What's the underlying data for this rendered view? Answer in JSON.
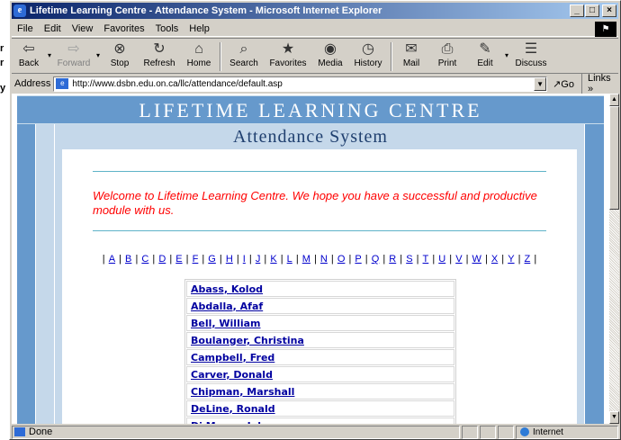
{
  "window": {
    "title": "Lifetime Learning Centre - Attendance System - Microsoft Internet Explorer",
    "buttons": {
      "minimize": "_",
      "maximize": "□",
      "close": "×"
    }
  },
  "outside_text": {
    "a": "r",
    "b": "r",
    "c": "y"
  },
  "menu": [
    "File",
    "Edit",
    "View",
    "Favorites",
    "Tools",
    "Help"
  ],
  "toolbar": [
    {
      "label": "Back",
      "icon": "back-arrow-icon",
      "glyph": "⇦"
    },
    {
      "label": "Forward",
      "icon": "forward-arrow-icon",
      "glyph": "⇨",
      "disabled": true
    },
    {
      "label": "Stop",
      "icon": "stop-icon",
      "glyph": "⊗"
    },
    {
      "label": "Refresh",
      "icon": "refresh-icon",
      "glyph": "↻"
    },
    {
      "label": "Home",
      "icon": "home-icon",
      "glyph": "⌂"
    },
    {
      "label": "Search",
      "icon": "search-icon",
      "glyph": "⌕"
    },
    {
      "label": "Favorites",
      "icon": "favorites-icon",
      "glyph": "★"
    },
    {
      "label": "Media",
      "icon": "media-icon",
      "glyph": "◉"
    },
    {
      "label": "History",
      "icon": "history-icon",
      "glyph": "◷"
    },
    {
      "label": "Mail",
      "icon": "mail-icon",
      "glyph": "✉"
    },
    {
      "label": "Print",
      "icon": "print-icon",
      "glyph": "⎙"
    },
    {
      "label": "Edit",
      "icon": "edit-icon",
      "glyph": "✎"
    },
    {
      "label": "Discuss",
      "icon": "discuss-icon",
      "glyph": "☰"
    }
  ],
  "address": {
    "label": "Address",
    "url": "http://www.dsbn.edu.on.ca/llc/attendance/default.asp",
    "go": "Go",
    "links": "Links »"
  },
  "page": {
    "heading1": "LIFETIME LEARNING CENTRE",
    "heading2": "Attendance System",
    "welcome": "Welcome to Lifetime Learning Centre. We hope you have a successful and productive module with us.",
    "alphabet": [
      "A",
      "B",
      "C",
      "D",
      "E",
      "F",
      "G",
      "H",
      "I",
      "J",
      "K",
      "L",
      "M",
      "N",
      "O",
      "P",
      "Q",
      "R",
      "S",
      "T",
      "U",
      "V",
      "W",
      "X",
      "Y",
      "Z"
    ],
    "names": [
      "Abass, Kolod",
      "Abdalla, Afaf",
      "Bell, William",
      "Boulanger, Christina",
      "Campbell, Fred",
      "Carver, Donald",
      "Chipman, Marshall",
      "DeLine, Ronald",
      "Di Marco, John"
    ]
  },
  "status": {
    "text": "Done",
    "zone": "Internet"
  },
  "colors": {
    "title_bar": "#0a246a",
    "banner": "#6699cc",
    "banner_light": "#c5d8ea",
    "welcome": "#ff0000",
    "link": "#0000a0"
  }
}
